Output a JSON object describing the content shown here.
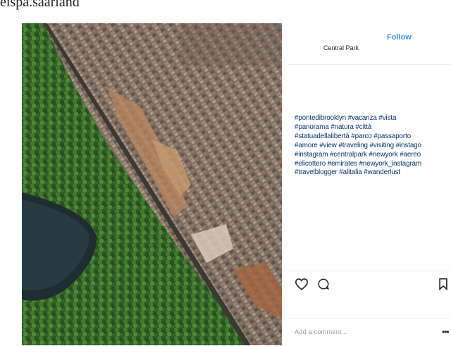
{
  "page": {
    "top_text": "eispa.saarland"
  },
  "post": {
    "location": "Central Park",
    "follow_label": "Follow",
    "caption_lines": [
      "#pontedibrooklyn #vacanza #vista",
      "#panorama #natura #città",
      "#statuadellalibertà #parco #passaporto",
      "#amore #view #traveling #visiting #instago",
      "#instagram #centralpark #newyork #aereo",
      "#elicottero #emirates #newyork_instagram",
      "#travelblogger #alitalia #wanderlust"
    ],
    "comment_placeholder": "Add a comment...",
    "more_label": "•••"
  },
  "icons": {
    "like": "heart-icon",
    "comment": "comment-icon",
    "save": "bookmark-icon"
  },
  "colors": {
    "follow": "#3897f0",
    "hashtag": "#003569",
    "divider": "#ececec"
  }
}
